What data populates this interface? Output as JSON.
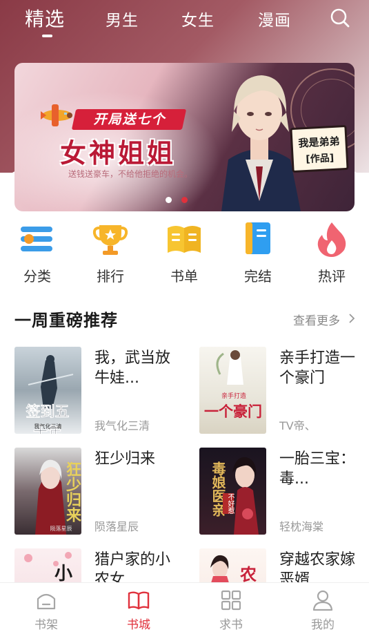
{
  "top_tabs": [
    {
      "label": "精选",
      "active": true
    },
    {
      "label": "男生",
      "active": false
    },
    {
      "label": "女生",
      "active": false
    },
    {
      "label": "漫画",
      "active": false
    }
  ],
  "banner": {
    "ribbon": "开局送七个",
    "title": "女神姐姐",
    "subtitle": "送钱送豪车，不给他拒绝的机会。",
    "tag_line1": "我是弟弟",
    "tag_line2": "[作品]",
    "active_dot": 2,
    "dot_count": 2
  },
  "categories": [
    {
      "label": "分类",
      "icon": "category-list-icon"
    },
    {
      "label": "排行",
      "icon": "trophy-icon"
    },
    {
      "label": "书单",
      "icon": "open-book-icon"
    },
    {
      "label": "完结",
      "icon": "notebook-icon"
    },
    {
      "label": "热评",
      "icon": "flame-icon"
    }
  ],
  "section": {
    "title": "一周重磅推荐",
    "more": "查看更多"
  },
  "books": [
    {
      "title": "我，武当放牛娃...",
      "author": "我气化三清",
      "cover_text": "签到五十年",
      "cover_sub": "我气化三清"
    },
    {
      "title": "亲手打造一个豪门",
      "author": "TV帝、",
      "cover_text": "一个豪门",
      "cover_sub": "亲手打造"
    },
    {
      "title": "狂少归来",
      "author": "陨落星辰",
      "cover_text": "狂少归来",
      "cover_sub": "陨落星辰"
    },
    {
      "title": "一胎三宝：毒...",
      "author": "轻枕海棠",
      "cover_text": "毒娘医亲",
      "cover_sub": "不好惹"
    },
    {
      "title": "猎户家的小农女",
      "author": "",
      "cover_text": "小",
      "cover_sub": ""
    },
    {
      "title": "穿越农家嫁恶婿",
      "author": "",
      "cover_text": "农",
      "cover_sub": ""
    }
  ],
  "bottom_nav": [
    {
      "label": "书架",
      "icon": "bookshelf-icon",
      "active": false
    },
    {
      "label": "书城",
      "icon": "bookstore-icon",
      "active": true
    },
    {
      "label": "求书",
      "icon": "grid-icon",
      "active": false
    },
    {
      "label": "我的",
      "icon": "user-icon",
      "active": false
    }
  ],
  "colors": {
    "accent": "#e0313c",
    "header_start": "#8a3a46",
    "text_primary": "#1f1f1f",
    "text_secondary": "#999999"
  }
}
